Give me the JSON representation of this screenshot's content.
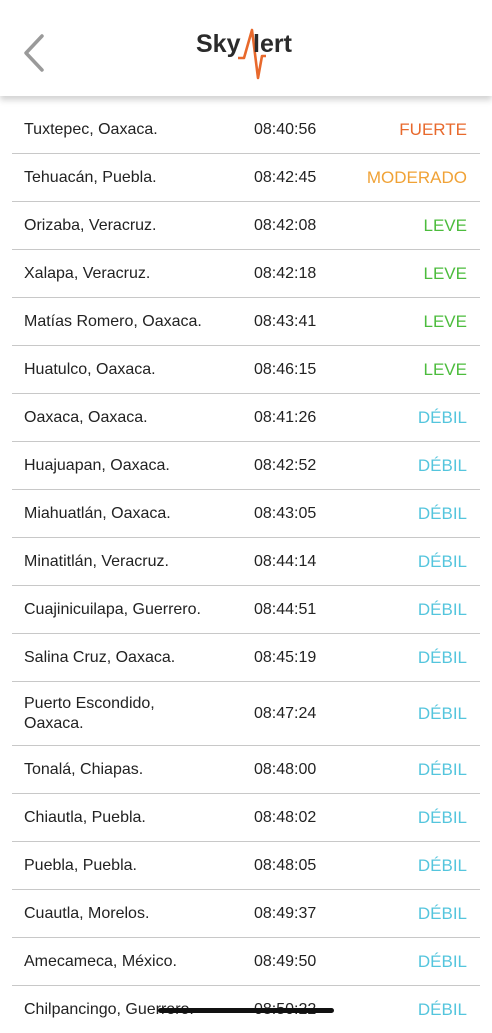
{
  "header": {
    "logo_left": "Sky",
    "logo_right": "lert",
    "back_icon": "chevron-left-icon"
  },
  "colors": {
    "fuerte": "#e8692c",
    "moderado": "#f0a236",
    "leve": "#4cbc3d",
    "debil": "#54c5dd",
    "logo_accent": "#e8692c"
  },
  "rows": [
    {
      "city": "Tuxtepec, Oaxaca.",
      "time": "08:40:56",
      "level": "FUERTE",
      "cls": "lv-fuerte"
    },
    {
      "city": "Tehuacán, Puebla.",
      "time": "08:42:45",
      "level": "MODERADO",
      "cls": "lv-moderado"
    },
    {
      "city": "Orizaba, Veracruz.",
      "time": "08:42:08",
      "level": "LEVE",
      "cls": "lv-leve"
    },
    {
      "city": "Xalapa, Veracruz.",
      "time": "08:42:18",
      "level": "LEVE",
      "cls": "lv-leve"
    },
    {
      "city": "Matías Romero, Oaxaca.",
      "time": "08:43:41",
      "level": "LEVE",
      "cls": "lv-leve"
    },
    {
      "city": "Huatulco, Oaxaca.",
      "time": "08:46:15",
      "level": "LEVE",
      "cls": "lv-leve"
    },
    {
      "city": "Oaxaca, Oaxaca.",
      "time": "08:41:26",
      "level": "DÉBIL",
      "cls": "lv-debil"
    },
    {
      "city": "Huajuapan, Oaxaca.",
      "time": "08:42:52",
      "level": "DÉBIL",
      "cls": "lv-debil"
    },
    {
      "city": "Miahuatlán, Oaxaca.",
      "time": "08:43:05",
      "level": "DÉBIL",
      "cls": "lv-debil"
    },
    {
      "city": "Minatitlán, Veracruz.",
      "time": "08:44:14",
      "level": "DÉBIL",
      "cls": "lv-debil"
    },
    {
      "city": "Cuajinicuilapa, Guerrero.",
      "time": "08:44:51",
      "level": "DÉBIL",
      "cls": "lv-debil"
    },
    {
      "city": "Salina Cruz, Oaxaca.",
      "time": "08:45:19",
      "level": "DÉBIL",
      "cls": "lv-debil"
    },
    {
      "city": "Puerto Escondido,\nOaxaca.",
      "time": "08:47:24",
      "level": "DÉBIL",
      "cls": "lv-debil"
    },
    {
      "city": "Tonalá, Chiapas.",
      "time": "08:48:00",
      "level": "DÉBIL",
      "cls": "lv-debil"
    },
    {
      "city": "Chiautla, Puebla.",
      "time": "08:48:02",
      "level": "DÉBIL",
      "cls": "lv-debil"
    },
    {
      "city": "Puebla, Puebla.",
      "time": "08:48:05",
      "level": "DÉBIL",
      "cls": "lv-debil"
    },
    {
      "city": "Cuautla, Morelos.",
      "time": "08:49:37",
      "level": "DÉBIL",
      "cls": "lv-debil"
    },
    {
      "city": "Amecameca, México.",
      "time": "08:49:50",
      "level": "DÉBIL",
      "cls": "lv-debil"
    },
    {
      "city": "Chilpancingo, Guerrero.",
      "time": "08:50:22",
      "level": "DÉBIL",
      "cls": "lv-debil"
    }
  ]
}
